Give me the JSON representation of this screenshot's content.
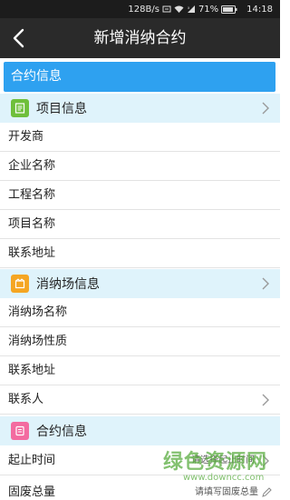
{
  "status_bar": {
    "speed": "128B/s",
    "battery": "71%",
    "time": "14:18"
  },
  "header": {
    "title": "新增消纳合约"
  },
  "section_title": "合约信息",
  "groups": [
    {
      "label": "项目信息",
      "icon": "document-icon",
      "color": "#6fbf3b",
      "fields": [
        "开发商",
        "企业名称",
        "工程名称",
        "项目名称",
        "联系地址"
      ]
    },
    {
      "label": "消纳场信息",
      "icon": "site-icon",
      "color": "#f5a623",
      "fields": [
        "消纳场名称",
        "消纳场性质",
        "联系地址",
        "联系人"
      ]
    },
    {
      "label": "合约信息",
      "icon": "contract-icon",
      "color": "#f36ba0",
      "fields": [
        "起止时间",
        "固废总量"
      ]
    }
  ],
  "placeholders": {
    "period": "请选择起止时间",
    "waste_total": "请填写固废总量"
  },
  "watermark": {
    "text": "绿色资源网",
    "url": "www.downcc.com"
  }
}
